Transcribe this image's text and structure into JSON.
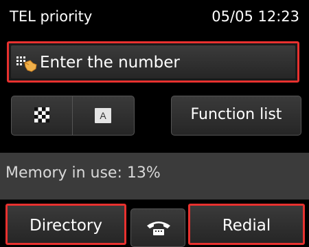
{
  "header": {
    "title": "TEL priority",
    "datetime": "05/05 12:23"
  },
  "enter_number": {
    "label": "Enter the number",
    "icon": "keypad-tap-icon"
  },
  "toggle": {
    "left_icon": "checker-icon",
    "right_icon": "alpha-icon",
    "right_letter": "A"
  },
  "function_list": {
    "label": "Function list"
  },
  "memory": {
    "text": "Memory in use: 13%"
  },
  "bottom": {
    "directory_label": "Directory",
    "hook_icon": "phone-hook-icon",
    "redial_label": "Redial"
  },
  "colors": {
    "highlight": "#e8312f",
    "background": "#000000",
    "button": "#2e2e2e",
    "memory_bar": "#3b3b3b"
  }
}
